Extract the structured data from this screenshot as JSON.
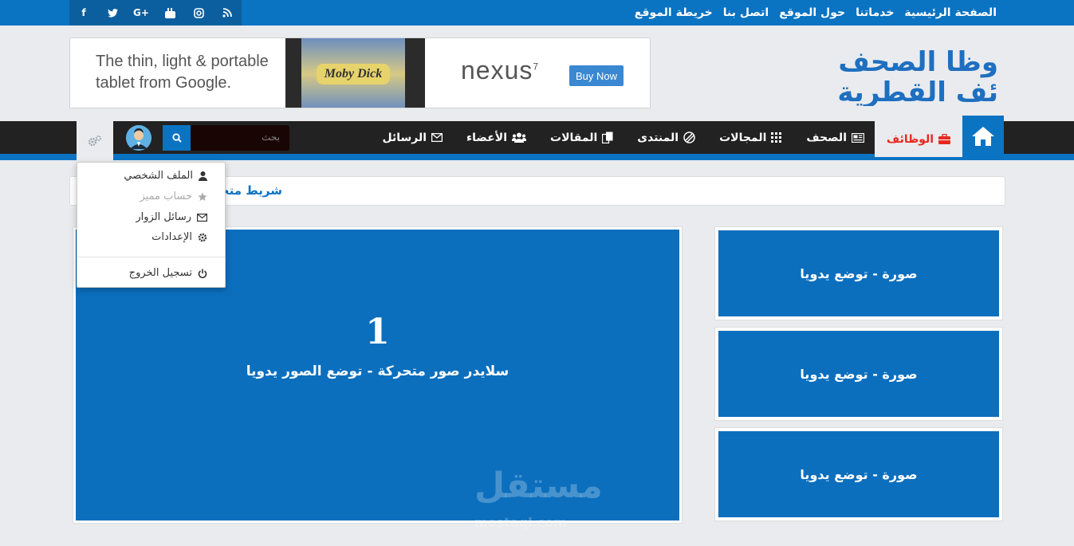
{
  "colors": {
    "brand": "#0a73c2",
    "nav_bg": "#222222",
    "accent_red": "#e8281f",
    "page_bg": "#e9ebee"
  },
  "social": [
    {
      "name": "facebook-icon",
      "glyph": "f"
    },
    {
      "name": "twitter-icon",
      "glyph": "t"
    },
    {
      "name": "google-plus-icon",
      "glyph": "G+"
    },
    {
      "name": "youtube-icon",
      "glyph": "▶"
    },
    {
      "name": "instagram-icon",
      "glyph": "◎"
    },
    {
      "name": "rss-icon",
      "glyph": "◉"
    }
  ],
  "top_links": [
    "الصفحة الرئيسية",
    "خدماتنا",
    "حول الموقع",
    "اتصل بنا",
    "خريطة الموقع"
  ],
  "logo": {
    "line1": "وظا الصحف",
    "line2": "ئف القطرية"
  },
  "ad": {
    "text_line1": "The thin, light & portable",
    "text_line2": "tablet from Google.",
    "book_title": "Moby Dick",
    "brand": "nexus",
    "brand_sup": "7",
    "cta": "Buy Now"
  },
  "nav": {
    "jobs": "الوظائف",
    "items": [
      "الصحف",
      "المجالات",
      "المنتدى",
      "المقالات",
      "الأعضاء",
      "الرسائل"
    ],
    "search_placeholder": "بحث"
  },
  "ticker": {
    "label": "شريط متحرك"
  },
  "slider": {
    "number": "1",
    "caption": "سلايدر صور متحركة - توضع الصور يدويا"
  },
  "side_cards": [
    "صورة - توضع يدويا",
    "صورة - توضع يدويا",
    "صورة - توضع يدويا"
  ],
  "dropdown": {
    "profile": "الملف الشخصي",
    "premium": "حساب مميز",
    "visitor_messages": "رسائل الزوار",
    "settings": "الإعدادات",
    "logout": "تسجيل الخروج"
  },
  "watermark": {
    "main": "مستقل",
    "sub": "mostaql.com"
  }
}
